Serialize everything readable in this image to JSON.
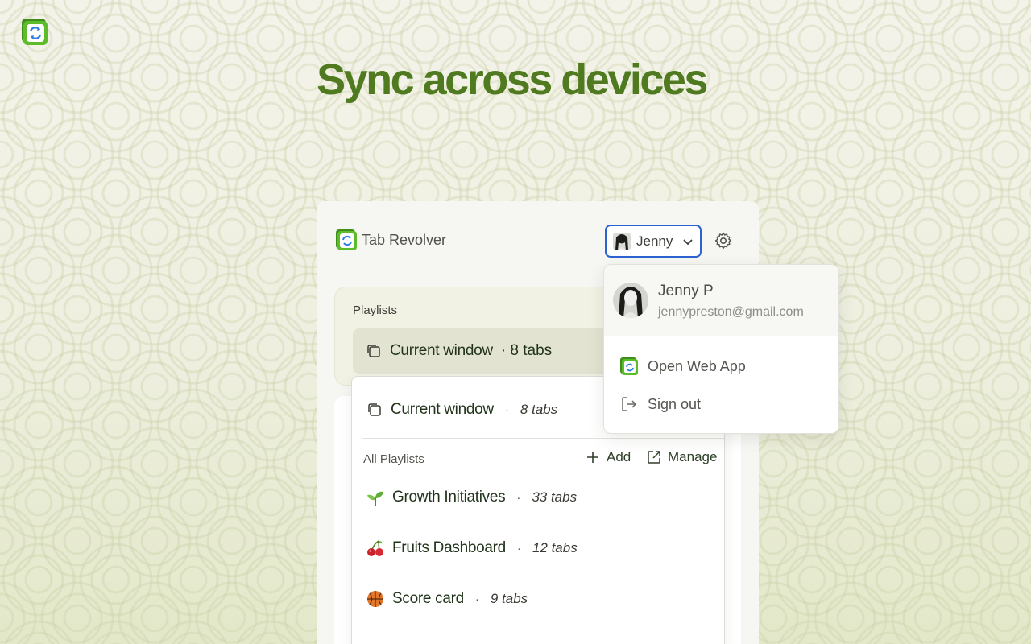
{
  "hero": {
    "title": "Sync across devices"
  },
  "app": {
    "name": "Tab Revolver",
    "logo_icon": "tab-revolver-logo-icon"
  },
  "user_menu": {
    "button_label": "Jenny",
    "avatar_icon": "user-avatar-icon",
    "chevron_icon": "chevron-down-icon"
  },
  "settings": {
    "icon": "gear-icon"
  },
  "playlists": {
    "label": "Playlists",
    "selected": {
      "name": "Current window",
      "count": "· 8 tabs",
      "icon": "window-stack-icon"
    }
  },
  "dropdown": {
    "current": {
      "name": "Current window",
      "separator": "·",
      "count": "8 tabs"
    },
    "section_label": "All Playlists",
    "add_label": "Add",
    "manage_label": "Manage",
    "items": [
      {
        "name": "Growth Initiatives",
        "separator": "·",
        "count": "33 tabs",
        "icon": "seedling-icon"
      },
      {
        "name": "Fruits Dashboard",
        "separator": "·",
        "count": "12 tabs",
        "icon": "cherries-icon"
      },
      {
        "name": "Score card",
        "separator": "·",
        "count": "9 tabs",
        "icon": "basketball-icon"
      }
    ]
  },
  "account": {
    "name": "Jenny P",
    "email": "jennypreston@gmail.com",
    "open_web_app": "Open Web App",
    "sign_out": "Sign out"
  },
  "colors": {
    "headline_green": "#4f7a1f",
    "logo_green": "#55b52a",
    "focus_blue": "#2d63d0",
    "text_dark_green": "#22351c"
  }
}
